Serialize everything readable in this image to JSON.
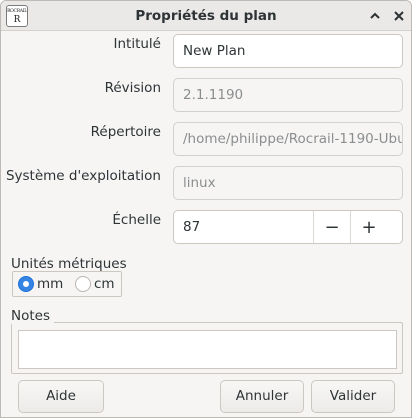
{
  "window": {
    "title": "Propriétés du plan",
    "app_icon_line1": "ROCRAIL",
    "app_icon_line2": "R"
  },
  "form": {
    "title_label": "Intitulé",
    "title_value": "New Plan",
    "revision_label": "Révision",
    "revision_value": "2.1.1190",
    "directory_label": "Répertoire",
    "directory_value": "/home/philippe/Rocrail-1190-Ubu",
    "os_label": "Système d'exploitation",
    "os_value": "linux",
    "scale_label": "Échelle",
    "scale_value": "87",
    "minus": "−",
    "plus": "+"
  },
  "units": {
    "label": "Unités métriques",
    "options": [
      "mm",
      "cm"
    ],
    "selected": "mm"
  },
  "notes": {
    "label": "Notes",
    "value": ""
  },
  "buttons": {
    "help": "Aide",
    "cancel": "Annuler",
    "ok": "Valider"
  },
  "colors": {
    "accent": "#3584e4",
    "window_bg": "#f6f5f4",
    "titlebar_bg": "#ebe9e7"
  }
}
